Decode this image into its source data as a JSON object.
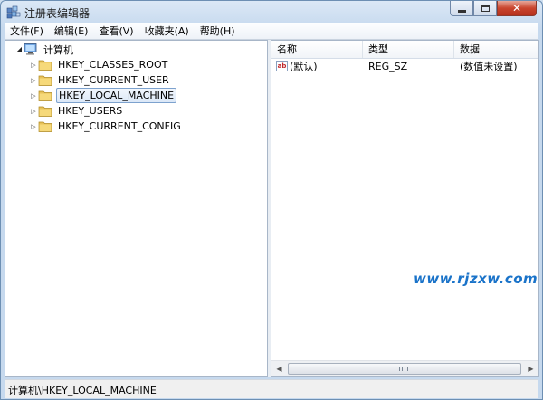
{
  "window": {
    "title": "注册表编辑器"
  },
  "menu": [
    "文件(F)",
    "编辑(E)",
    "查看(V)",
    "收藏夹(A)",
    "帮助(H)"
  ],
  "tree": {
    "root": "计算机",
    "keys": [
      "HKEY_CLASSES_ROOT",
      "HKEY_CURRENT_USER",
      "HKEY_LOCAL_MACHINE",
      "HKEY_USERS",
      "HKEY_CURRENT_CONFIG"
    ],
    "selected_key": "HKEY_LOCAL_MACHINE"
  },
  "list": {
    "columns": [
      "名称",
      "类型",
      "数据"
    ],
    "rows": [
      {
        "name": "(默认)",
        "type": "REG_SZ",
        "data": "(数值未设置)",
        "icon": "string-value-icon"
      }
    ]
  },
  "watermark": "www.rjzxw.com",
  "status": {
    "path": "计算机\\HKEY_LOCAL_MACHINE"
  },
  "icons": {
    "app": "registry-editor-icon",
    "root": "computer-icon",
    "key": "folder-icon"
  },
  "colors": {
    "folder": "#e8c25a",
    "selection_border": "#7da2ce",
    "close_button": "#c9452e",
    "watermark": "#1a73c9"
  }
}
